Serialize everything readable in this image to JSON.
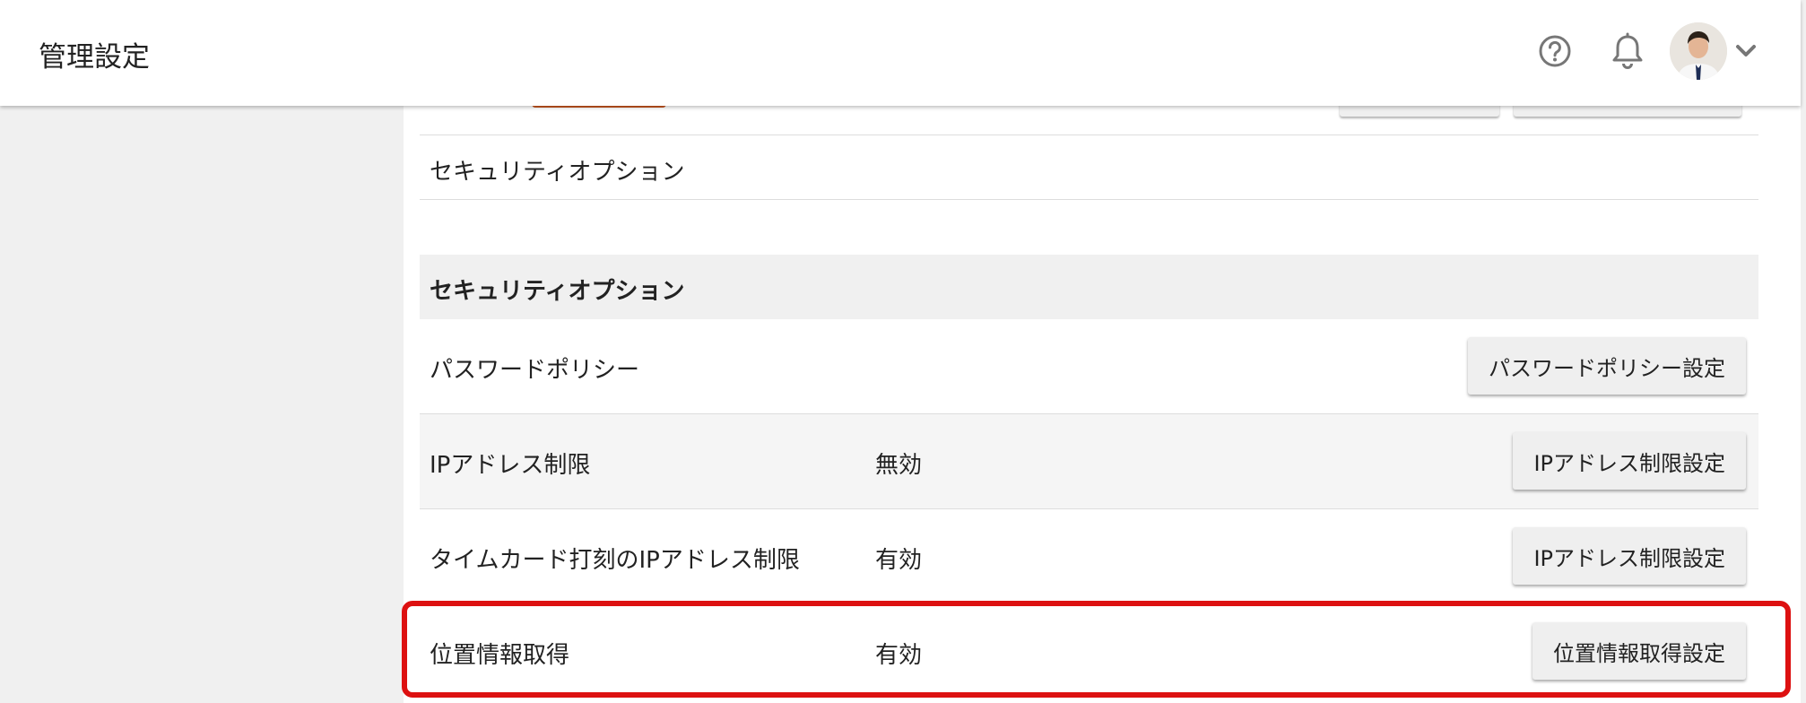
{
  "header": {
    "title": "管理設定",
    "icons": {
      "help": "help-circle-icon",
      "bell": "bell-icon",
      "chevron": "chevron-down-icon"
    }
  },
  "menu_item": {
    "label": "セキュリティオプション"
  },
  "section": {
    "title": "セキュリティオプション"
  },
  "rows": [
    {
      "label": "パスワードポリシー",
      "status": "",
      "button": "パスワードポリシー設定"
    },
    {
      "label": "IPアドレス制限",
      "status": "無効",
      "button": "IPアドレス制限設定"
    },
    {
      "label": "タイムカード打刻のIPアドレス制限",
      "status": "有効",
      "button": "IPアドレス制限設定"
    },
    {
      "label": "位置情報取得",
      "status": "有効",
      "button": "位置情報取得設定"
    }
  ],
  "colors": {
    "highlight": "#dd1111",
    "accent": "#c8561f",
    "row_alt": "#f5f5f5",
    "section_bg": "#f0f0f0"
  }
}
